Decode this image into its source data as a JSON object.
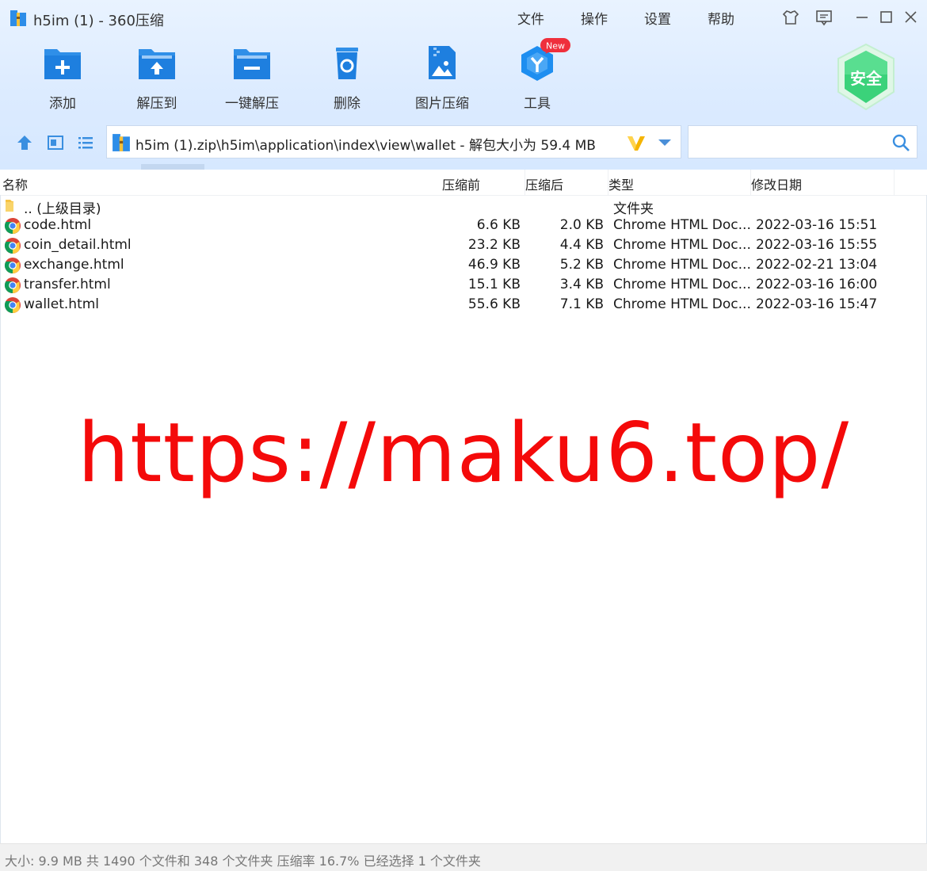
{
  "window": {
    "title": "h5im (1) - 360压缩",
    "menu": [
      "文件",
      "操作",
      "设置",
      "帮助"
    ]
  },
  "toolbar": {
    "items": [
      {
        "label": "添加",
        "icon": "add-folder-icon"
      },
      {
        "label": "解压到",
        "icon": "extract-to-icon"
      },
      {
        "label": "一键解压",
        "icon": "one-click-extract-icon"
      },
      {
        "label": "删除",
        "icon": "delete-icon"
      },
      {
        "label": "图片压缩",
        "icon": "image-compress-icon"
      },
      {
        "label": "工具",
        "icon": "tools-icon"
      }
    ],
    "new_badge": "New",
    "security_label": "安全"
  },
  "pathbar": {
    "path": "h5im (1).zip\\h5im\\application\\index\\view\\wallet - 解包大小为 59.4 MB",
    "search_value": ""
  },
  "columns": {
    "name": "名称",
    "packed_before": "压缩前",
    "packed_after": "压缩后",
    "type": "类型",
    "modified": "修改日期"
  },
  "rows": [
    {
      "name": ".. (上级目录)",
      "before": "",
      "after": "",
      "type": "文件夹",
      "date": "",
      "icon": "folder-icon"
    },
    {
      "name": "code.html",
      "before": "6.6 KB",
      "after": "2.0 KB",
      "type": "Chrome HTML Doc...",
      "date": "2022-03-16 15:51",
      "icon": "chrome-icon"
    },
    {
      "name": "coin_detail.html",
      "before": "23.2 KB",
      "after": "4.4 KB",
      "type": "Chrome HTML Doc...",
      "date": "2022-03-16 15:55",
      "icon": "chrome-icon"
    },
    {
      "name": "exchange.html",
      "before": "46.9 KB",
      "after": "5.2 KB",
      "type": "Chrome HTML Doc...",
      "date": "2022-02-21 13:04",
      "icon": "chrome-icon"
    },
    {
      "name": "transfer.html",
      "before": "15.1 KB",
      "after": "3.4 KB",
      "type": "Chrome HTML Doc...",
      "date": "2022-03-16 16:00",
      "icon": "chrome-icon"
    },
    {
      "name": "wallet.html",
      "before": "55.6 KB",
      "after": "7.1 KB",
      "type": "Chrome HTML Doc...",
      "date": "2022-03-16 15:47",
      "icon": "chrome-icon"
    }
  ],
  "watermark": "https://maku6.top/",
  "status": "大小: 9.9 MB 共 1490 个文件和 348 个文件夹 压缩率 16.7% 已经选择 1 个文件夹",
  "colors": {
    "accent": "#1e8ef0",
    "watermark": "#f40a0a",
    "security": "#33c96b"
  }
}
